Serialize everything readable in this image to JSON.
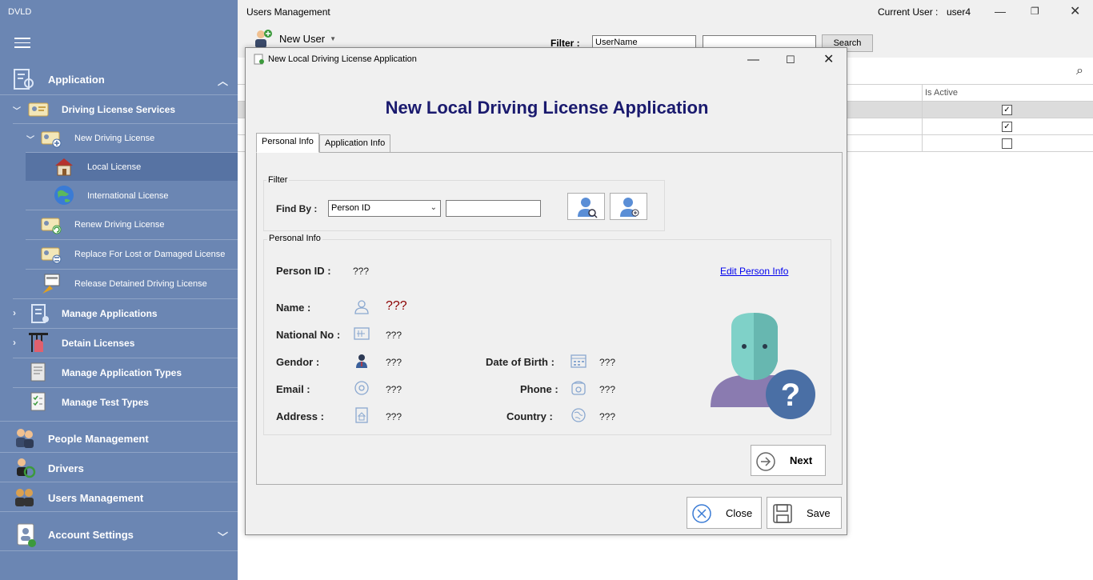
{
  "app": {
    "title": "DVLD"
  },
  "sidebar": {
    "items": [
      {
        "label": "Application",
        "icon": "application-icon"
      },
      {
        "label": "Driving License Services",
        "icon": "license-card-icon"
      },
      {
        "label": "New Driving License",
        "icon": "new-license-icon"
      },
      {
        "label": "Local License",
        "icon": "house-icon"
      },
      {
        "label": "International License",
        "icon": "globe-icon"
      },
      {
        "label": "Renew Driving License",
        "icon": "renew-license-icon"
      },
      {
        "label": "Replace For Lost or Damaged License",
        "icon": "replace-license-icon"
      },
      {
        "label": "Release Detained Driving License",
        "icon": "release-license-icon"
      },
      {
        "label": "Manage Applications",
        "icon": "manage-applications-icon"
      },
      {
        "label": "Detain Licenses",
        "icon": "detain-hand-icon"
      },
      {
        "label": "Manage Application Types",
        "icon": "application-types-icon"
      },
      {
        "label": "Manage Test Types",
        "icon": "test-types-icon"
      },
      {
        "label": "People Management",
        "icon": "people-icon"
      },
      {
        "label": "Drivers",
        "icon": "drivers-icon"
      },
      {
        "label": "Users Management",
        "icon": "users-icon"
      },
      {
        "label": "Account Settings",
        "icon": "account-settings-icon"
      }
    ],
    "bg_color": "#6b86b3"
  },
  "main": {
    "title": "Users Management",
    "current_user_label": "Current User :",
    "current_user": "user4",
    "new_user_label": "New User",
    "filter_label": "Filter :",
    "filter_value": "UserName",
    "search_label": "Search",
    "grid": {
      "columns": [
        "Is Active"
      ],
      "rows": [
        {
          "is_active": true
        },
        {
          "is_active": true
        },
        {
          "is_active": false
        }
      ]
    }
  },
  "dialog": {
    "title": "New Local Driving License Application",
    "heading": "New Local Driving License Application",
    "heading_color": "#1a1a6e",
    "tabs": [
      "Personal Info",
      "Application Info"
    ],
    "filter": {
      "group_title": "Filter",
      "find_by_label": "Find By :",
      "find_by_value": "Person ID",
      "search_value": ""
    },
    "personal_info": {
      "group_title": "Personal Info",
      "person_id_label": "Person ID :",
      "person_id": "???",
      "edit_link": "Edit Person Info",
      "name_label": "Name :",
      "name": "???",
      "national_no_label": "National No :",
      "national_no": "???",
      "gendor_label": "Gendor :",
      "gendor": "???",
      "dob_label": "Date of Birth :",
      "dob": "???",
      "email_label": "Email :",
      "email": "???",
      "phone_label": "Phone :",
      "phone": "???",
      "address_label": "Address :",
      "address": "???",
      "country_label": "Country :",
      "country": "???"
    },
    "next_label": "Next",
    "close_label": "Close",
    "save_label": "Save"
  }
}
